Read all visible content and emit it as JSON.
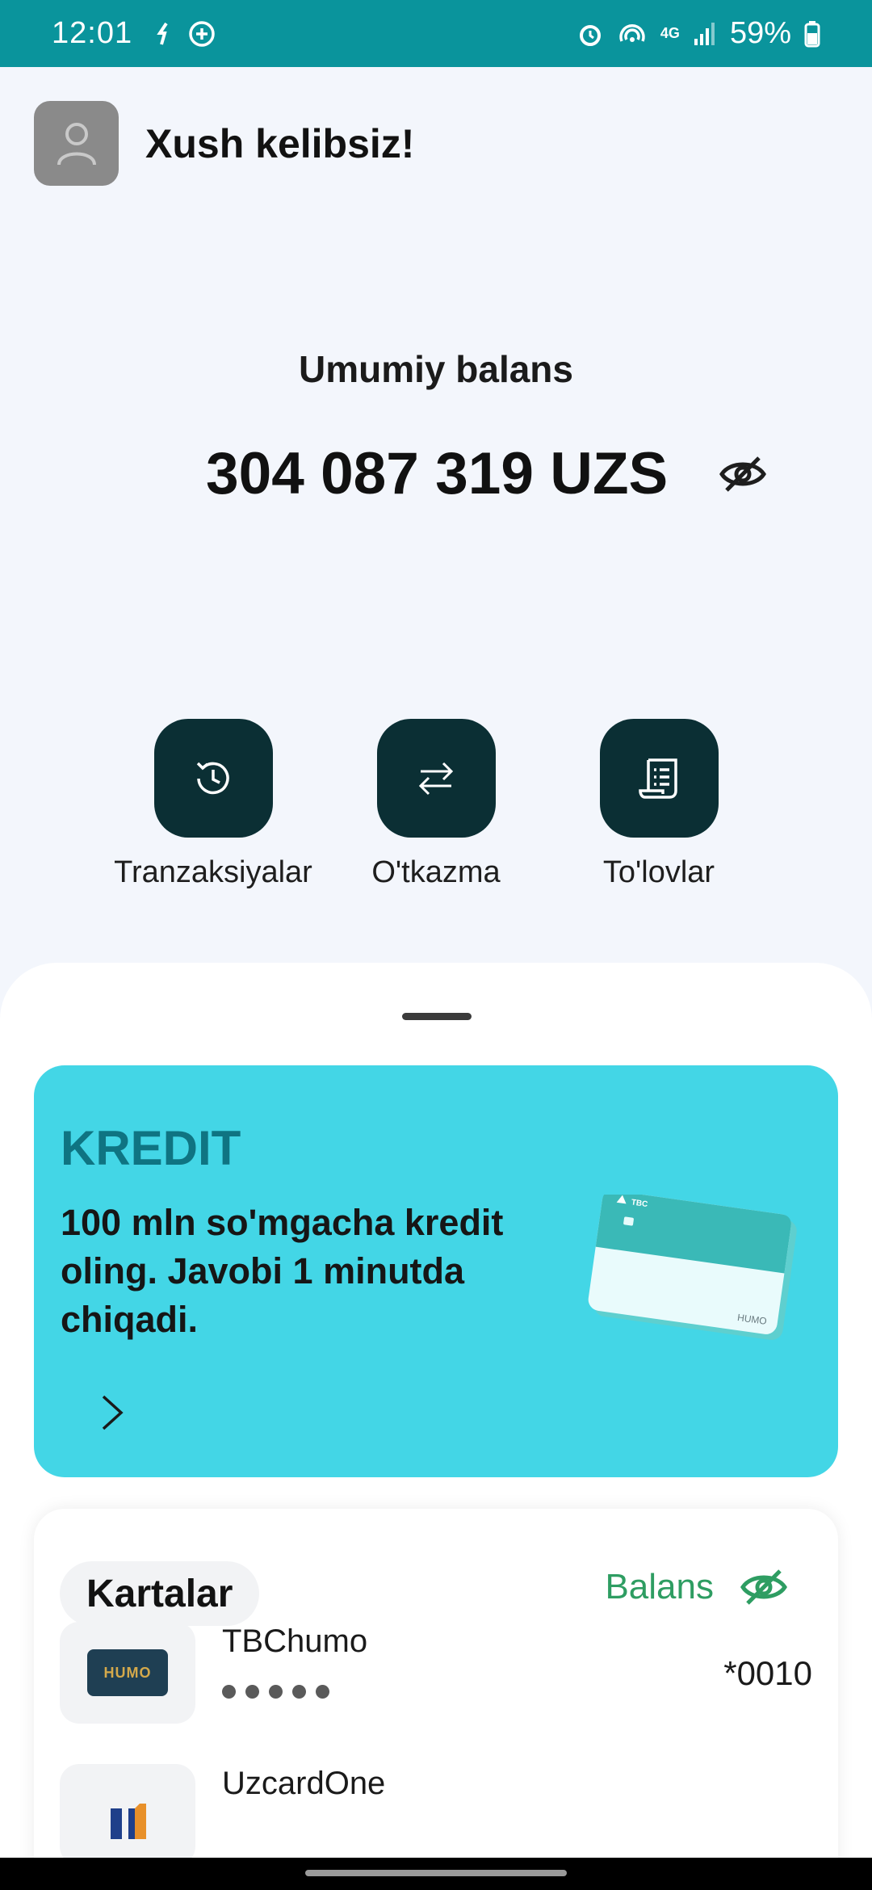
{
  "status_bar": {
    "time": "12:01",
    "battery": "59%",
    "network": "4G",
    "background_color": "#0a949c"
  },
  "header": {
    "greeting": "Xush kelibsiz!",
    "avatar_icon": "user-icon"
  },
  "balance": {
    "title": "Umumiy balans",
    "amount": "304 087 319 UZS",
    "visibility_icon": "eye-off-icon"
  },
  "actions": [
    {
      "label": "Tranzaksiyalar",
      "icon": "history-icon"
    },
    {
      "label": "O'tkazma",
      "icon": "transfer-arrows-icon"
    },
    {
      "label": "To'lovlar",
      "icon": "receipt-icon"
    }
  ],
  "promo": {
    "title": "KREDIT",
    "description": "100 mln so'mgacha kredit oling. Javobi 1 minutda chiqadi.",
    "background_color": "#43d6e6",
    "title_color": "#0f7482",
    "card_brand": "TBC",
    "card_network": "HUMO"
  },
  "cards_section": {
    "title": "Kartalar",
    "balance_toggle_label": "Balans",
    "accent_color": "#2e9d62",
    "cards": [
      {
        "name": "TBChumo",
        "masked_balance": "•••••",
        "number": "*0010",
        "logo": "HUMO"
      },
      {
        "name": "UzcardOne",
        "masked_balance": "",
        "number": "",
        "logo": "UZCARD"
      }
    ]
  },
  "colors": {
    "action_tile": "#0b2f34",
    "page_background": "#f3f6fc"
  }
}
